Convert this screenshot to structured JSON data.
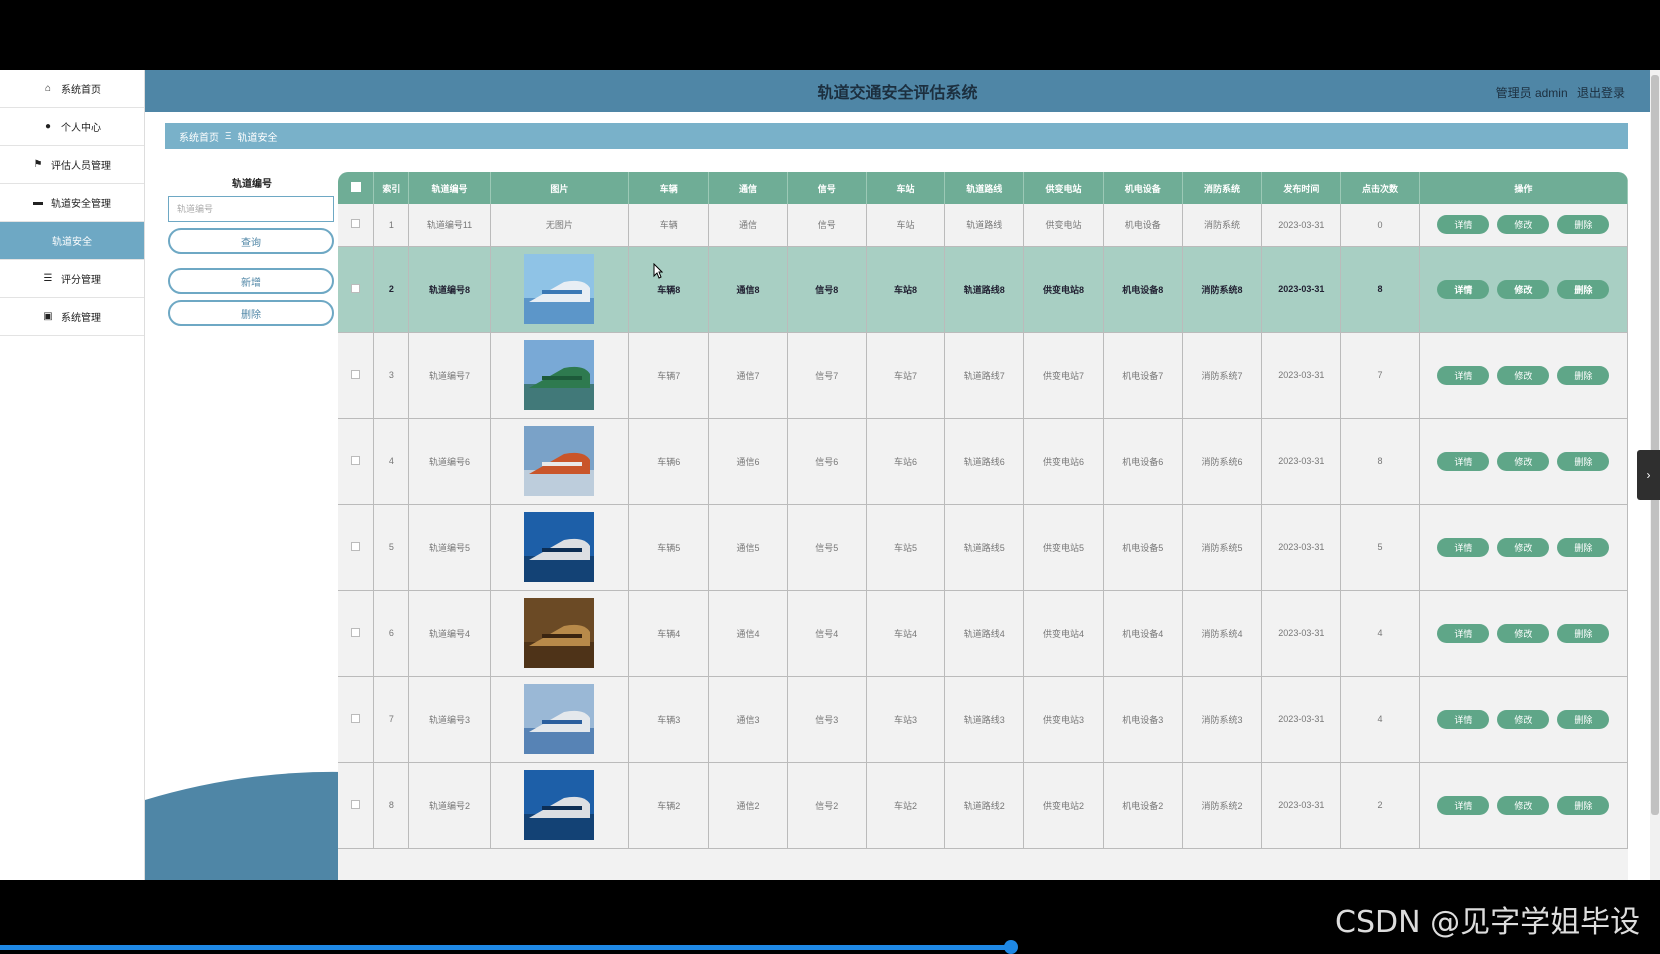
{
  "app": {
    "title": "轨道交通安全评估系统",
    "user_label": "管理员 admin",
    "logout_label": "退出登录"
  },
  "sidebar": {
    "items": [
      {
        "label": "系统首页",
        "icon": "home-icon"
      },
      {
        "label": "个人中心",
        "icon": "user-icon"
      },
      {
        "label": "评估人员管理",
        "icon": "flag-icon"
      },
      {
        "label": "轨道安全管理",
        "icon": "chat-icon"
      },
      {
        "label": "轨道安全",
        "icon": "",
        "active": true
      },
      {
        "label": "评分管理",
        "icon": "sliders-icon"
      },
      {
        "label": "系统管理",
        "icon": "clipboard-icon"
      }
    ]
  },
  "breadcrumb": {
    "home": "系统首页",
    "current": "轨道安全"
  },
  "search": {
    "label": "轨道编号",
    "placeholder": "轨道编号",
    "query_label": "查询",
    "add_label": "新增",
    "delete_label": "删除"
  },
  "table": {
    "headers": [
      "索引",
      "轨道编号",
      "图片",
      "车辆",
      "通信",
      "信号",
      "车站",
      "轨道路线",
      "供变电站",
      "机电设备",
      "消防系统",
      "发布时间",
      "点击次数",
      "操作"
    ],
    "op_labels": {
      "detail": "详情",
      "edit": "修改",
      "delete": "删除"
    },
    "rows": [
      {
        "index": "1",
        "code": "轨道编号11",
        "image": "无图片",
        "vehicle": "车辆",
        "comm": "通信",
        "signal": "信号",
        "station": "车站",
        "route": "轨道路线",
        "substation": "供变电站",
        "equipment": "机电设备",
        "fire": "消防系统",
        "time": "2023-03-31",
        "clicks": "0"
      },
      {
        "index": "2",
        "code": "轨道编号8",
        "image": "",
        "vehicle": "车辆8",
        "comm": "通信8",
        "signal": "信号8",
        "station": "车站8",
        "route": "轨道路线8",
        "substation": "供变电站8",
        "equipment": "机电设备8",
        "fire": "消防系统8",
        "time": "2023-03-31",
        "clicks": "8"
      },
      {
        "index": "3",
        "code": "轨道编号7",
        "image": "",
        "vehicle": "车辆7",
        "comm": "通信7",
        "signal": "信号7",
        "station": "车站7",
        "route": "轨道路线7",
        "substation": "供变电站7",
        "equipment": "机电设备7",
        "fire": "消防系统7",
        "time": "2023-03-31",
        "clicks": "7"
      },
      {
        "index": "4",
        "code": "轨道编号6",
        "image": "",
        "vehicle": "车辆6",
        "comm": "通信6",
        "signal": "信号6",
        "station": "车站6",
        "route": "轨道路线6",
        "substation": "供变电站6",
        "equipment": "机电设备6",
        "fire": "消防系统6",
        "time": "2023-03-31",
        "clicks": "8"
      },
      {
        "index": "5",
        "code": "轨道编号5",
        "image": "",
        "vehicle": "车辆5",
        "comm": "通信5",
        "signal": "信号5",
        "station": "车站5",
        "route": "轨道路线5",
        "substation": "供变电站5",
        "equipment": "机电设备5",
        "fire": "消防系统5",
        "time": "2023-03-31",
        "clicks": "5"
      },
      {
        "index": "6",
        "code": "轨道编号4",
        "image": "",
        "vehicle": "车辆4",
        "comm": "通信4",
        "signal": "信号4",
        "station": "车站4",
        "route": "轨道路线4",
        "substation": "供变电站4",
        "equipment": "机电设备4",
        "fire": "消防系统4",
        "time": "2023-03-31",
        "clicks": "4"
      },
      {
        "index": "7",
        "code": "轨道编号3",
        "image": "",
        "vehicle": "车辆3",
        "comm": "通信3",
        "signal": "信号3",
        "station": "车站3",
        "route": "轨道路线3",
        "substation": "供变电站3",
        "equipment": "机电设备3",
        "fire": "消防系统3",
        "time": "2023-03-31",
        "clicks": "4"
      },
      {
        "index": "8",
        "code": "轨道编号2",
        "image": "",
        "vehicle": "车辆2",
        "comm": "通信2",
        "signal": "信号2",
        "station": "车站2",
        "route": "轨道路线2",
        "substation": "供变电站2",
        "equipment": "机电设备2",
        "fire": "消防系统2",
        "time": "2023-03-31",
        "clicks": "2"
      }
    ]
  },
  "watermark": "CSDN @见字学姐毕设",
  "colors": {
    "header": "#4f86a6",
    "table_header": "#6fad96",
    "op_button": "#5fa688",
    "highlight_row": "#a8cfc3"
  }
}
